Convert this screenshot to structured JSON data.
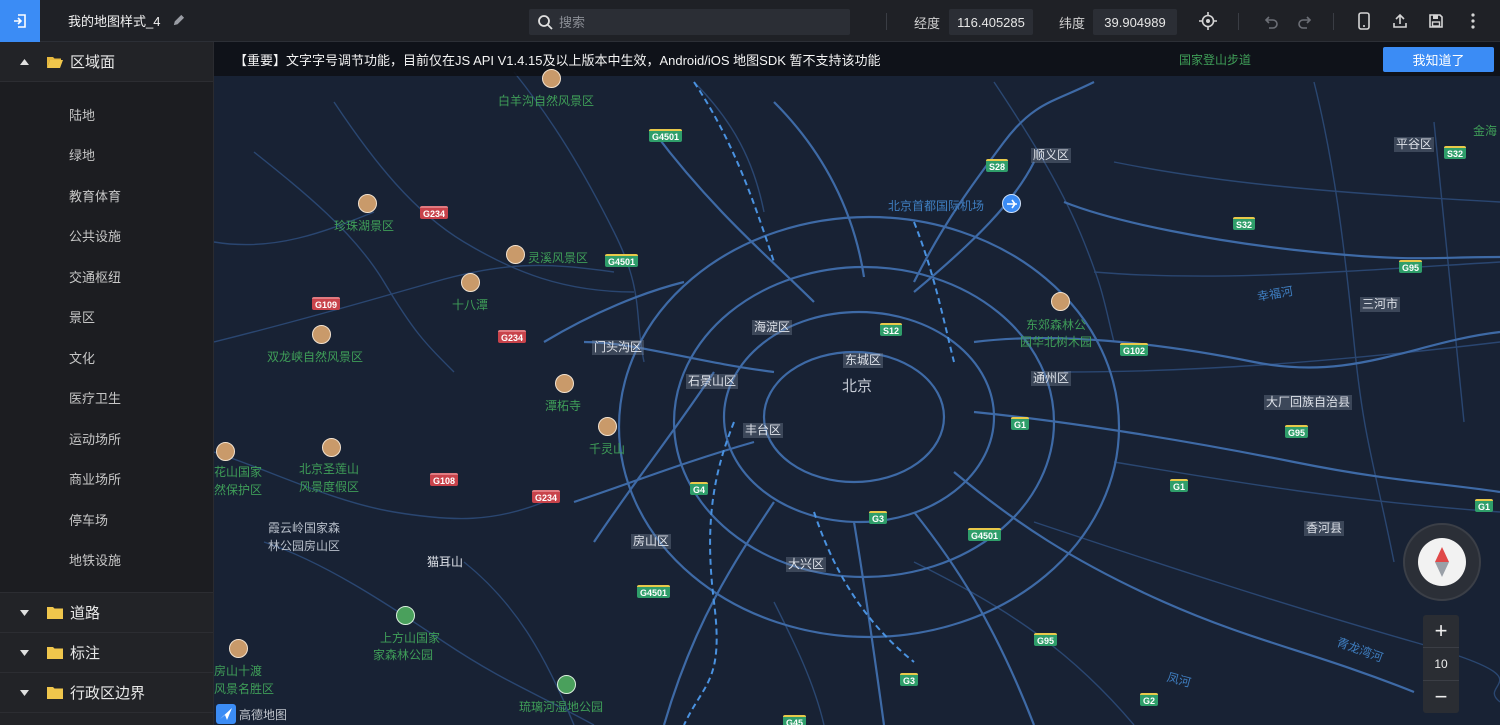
{
  "topbar": {
    "title": "我的地图样式_4",
    "search_placeholder": "搜索",
    "lng_label": "经度",
    "lng_value": "116.405285",
    "lat_label": "纬度",
    "lat_value": "39.904989",
    "icons": [
      "exit-icon",
      "edit-icon",
      "search-icon",
      "locate-icon",
      "undo-icon",
      "redo-icon",
      "mobile-icon",
      "upload-icon",
      "save-icon",
      "more-icon"
    ]
  },
  "sidebar": {
    "group_area": {
      "label": "区域面",
      "items": [
        "陆地",
        "绿地",
        "教育体育",
        "公共设施",
        "交通枢纽",
        "景区",
        "文化",
        "医疗卫生",
        "运动场所",
        "商业场所",
        "停车场",
        "地铁设施"
      ]
    },
    "group_road": {
      "label": "道路"
    },
    "group_label": {
      "label": "标注"
    },
    "group_admin": {
      "label": "行政区边界"
    }
  },
  "notice": {
    "text": "【重要】文字字号调节功能，目前仅在JS API V1.4.15及以上版本中生效，Android/iOS 地图SDK 暂不支持该功能",
    "button": "我知道了"
  },
  "map": {
    "labels": {
      "baiyanggou": "白羊沟自然风景区",
      "zhenzhuhu": "珍珠湖景区",
      "lingxi": "灵溪风景区",
      "shibatan": "十八潭",
      "shuanglongxia": "双龙峡自然风景区",
      "tanzhesi": "潭柘寺",
      "qianlingshan": "千灵山",
      "shengliansan": "北京圣莲山",
      "shenglian2": "风景度假区",
      "shanguojia": "花山国家",
      "baohuqu": "然保护区",
      "xiayunling": "霞云岭国家森",
      "linpark": "林公园房山区",
      "maoershan": "猫耳山",
      "shangfangshan": "上方山国家",
      "senlin": "家森林公园",
      "shidu": "房山十渡",
      "mingsheng": "风景名胜区",
      "liulihe": "琉璃河湿地公园",
      "dongjiao": "东郊森林公",
      "dongjiao2": "园华北树木园",
      "airport": "北京首都国际机场",
      "dengshan": "国家登山步道",
      "jinhai": "金海",
      "beijing": "北京"
    },
    "districts": {
      "shunyi": "顺义区",
      "pinggu": "平谷区",
      "sanhe": "三河市",
      "haidian": "海淀区",
      "dongcheng": "东城区",
      "mentougou": "门头沟区",
      "shijingshan": "石景山区",
      "tongzhou": "通州区",
      "fengtai": "丰台区",
      "dachang": "大厂回族自治县",
      "fangshan": "房山区",
      "daxing": "大兴区",
      "xianghe": "香河县"
    },
    "rivers": {
      "xingfu": "幸福河",
      "qinglongwan": "青龙湾河",
      "fenghe": "凤河"
    },
    "shields": {
      "g4501a": "G4501",
      "s28": "S28",
      "g234a": "G234",
      "g4501b": "G4501",
      "s32a": "S32",
      "s32b": "S32",
      "g95a": "G95",
      "g109": "G109",
      "s12": "S12",
      "g234b": "G234",
      "g102": "G102",
      "g95b": "G95",
      "g1a": "G1",
      "g108": "G108",
      "g234c": "G234",
      "g4": "G4",
      "g1b": "G1",
      "g3a": "G3",
      "g4501c": "G4501",
      "g1c": "G1",
      "g4501d": "G4501",
      "g95c": "G95",
      "g3b": "G3",
      "g2": "G2",
      "g45": "G45"
    },
    "zoom_level": "10",
    "logo": "高德地图"
  },
  "colors": {
    "accent": "#3b8cf5",
    "map_bg": "#182234",
    "road": "#3e6aa6"
  }
}
